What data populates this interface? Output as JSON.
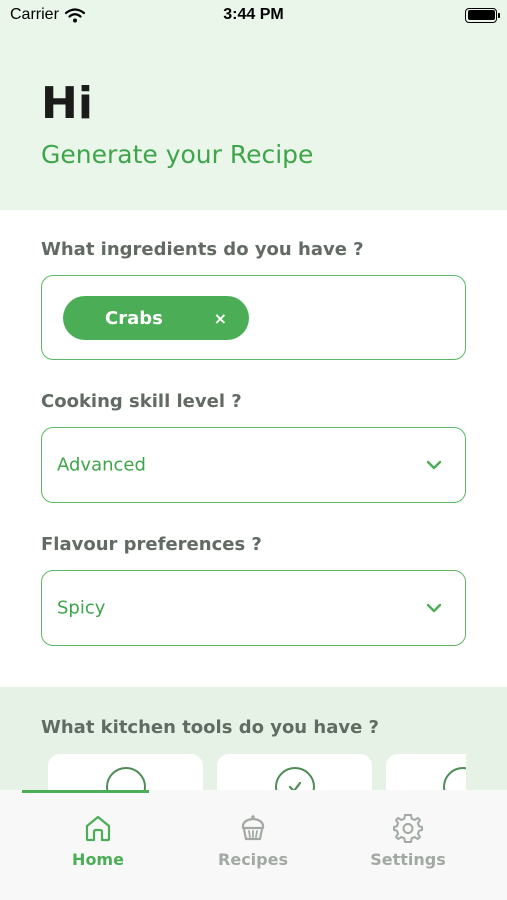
{
  "status_bar": {
    "carrier": "Carrier",
    "time": "3:44 PM"
  },
  "header": {
    "greeting": "Hi",
    "subtitle": "Generate your Recipe"
  },
  "ingredients": {
    "label": "What ingredients do you have ?",
    "chips": [
      {
        "label": "Crabs",
        "remove": "×"
      }
    ]
  },
  "skill": {
    "label": "Cooking skill level ?",
    "value": "Advanced"
  },
  "flavour": {
    "label": "Flavour preferences ?",
    "value": "Spicy"
  },
  "tools": {
    "label": "What kitchen tools do you have ?"
  },
  "tab_bar": {
    "items": [
      {
        "label": "Home",
        "icon": "home-icon"
      },
      {
        "label": "Recipes",
        "icon": "cupcake-icon"
      },
      {
        "label": "Settings",
        "icon": "gear-icon"
      }
    ]
  },
  "colors": {
    "accent": "#4bae56",
    "header_bg": "#eaf6ea",
    "label_text": "#616b63"
  }
}
